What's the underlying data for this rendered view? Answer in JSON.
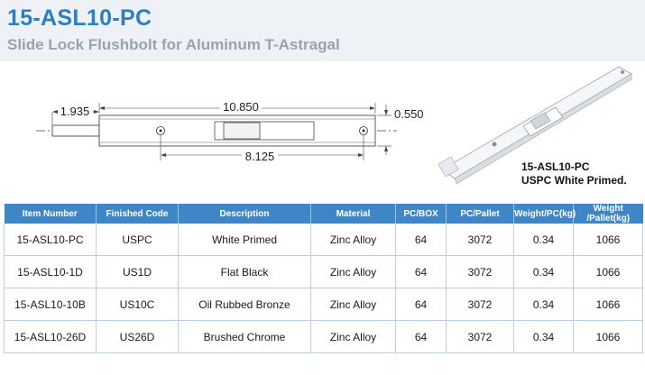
{
  "header": {
    "title": "15-ASL10-PC",
    "subtitle": "Slide Lock Flushbolt for Aluminum T-Astragal"
  },
  "drawing": {
    "dim_left": "1.935",
    "dim_top": "10.850",
    "dim_right": "0.550",
    "dim_bottom": "8.125"
  },
  "product_caption": {
    "line1": "15-ASL10-PC",
    "line2": "USPC White Primed."
  },
  "table": {
    "headers": [
      "Item Number",
      "Finished Code",
      "Description",
      "Material",
      "PC/BOX",
      "PC/Pallet",
      "Weight/PC(kg)",
      "Weight /Pallet(kg)"
    ],
    "rows": [
      [
        "15-ASL10-PC",
        "USPC",
        "White Primed",
        "Zinc Alloy",
        "64",
        "3072",
        "0.34",
        "1066"
      ],
      [
        "15-ASL10-1D",
        "US1D",
        "Flat Black",
        "Zinc Alloy",
        "64",
        "3072",
        "0.34",
        "1066"
      ],
      [
        "15-ASL10-10B",
        "US10C",
        "Oil Rubbed Bronze",
        "Zinc Alloy",
        "64",
        "3072",
        "0.34",
        "1066"
      ],
      [
        "15-ASL10-26D",
        "US26D",
        "Brushed Chrome",
        "Zinc Alloy",
        "64",
        "3072",
        "0.34",
        "1066"
      ]
    ]
  },
  "colors": {
    "title_blue": "#2d7fc0",
    "header_bg": "#3f86c6",
    "subtitle_gray": "#9aa3ab"
  }
}
